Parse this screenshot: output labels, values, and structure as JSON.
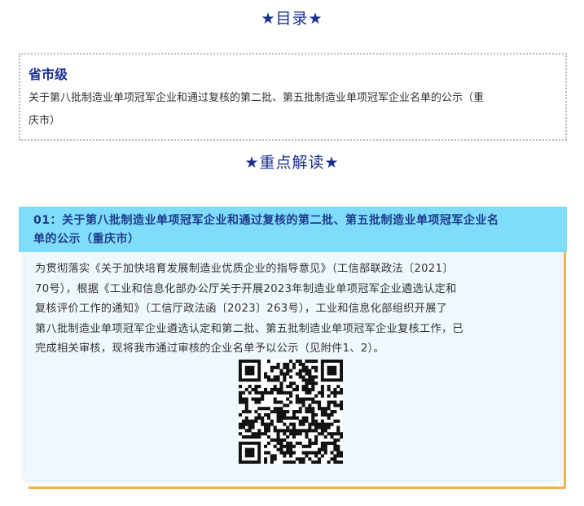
{
  "toc": {
    "title": "★目录★",
    "heading": "省市级",
    "link_line1": "关于第八批制造业单项冠军企业和通过复核的第二批、第五批制造业单项冠军企业名单的公示（重",
    "link_line2": "庆市）"
  },
  "key": {
    "title": "★重点解读★"
  },
  "article": {
    "header_line1": "01：关于第八批制造业单项冠军企业和通过复核的第二批、第五批制造业单项冠军企业名",
    "header_line2": "单的公示（重庆市）",
    "body_lines": [
      "为贯彻落实《关于加快培育发展制造业优质企业的指导意见》（工信部联政法〔2021〕",
      "70号），根据《工业和信息化部办公厅关于开展2023年制造业单项冠军企业遴选认定和",
      "复核评价工作的通知》（工信厅政法函〔2023〕263号），工业和信息化部组织开展了",
      "第八批制造业单项冠军企业遴选认定和第二批、第五批制造业单项冠军企业复核工作，已",
      "完成相关审核，现将我市通过审核的企业名单予以公示（见附件1、2）。"
    ]
  },
  "colors": {
    "title_blue": "#1a2f8f",
    "header_cyan": "#7fdcfb",
    "card_bg": "#eff8fc",
    "accent_orange": "#f4b24a"
  },
  "icons": {
    "qr": "qr-code-icon"
  }
}
